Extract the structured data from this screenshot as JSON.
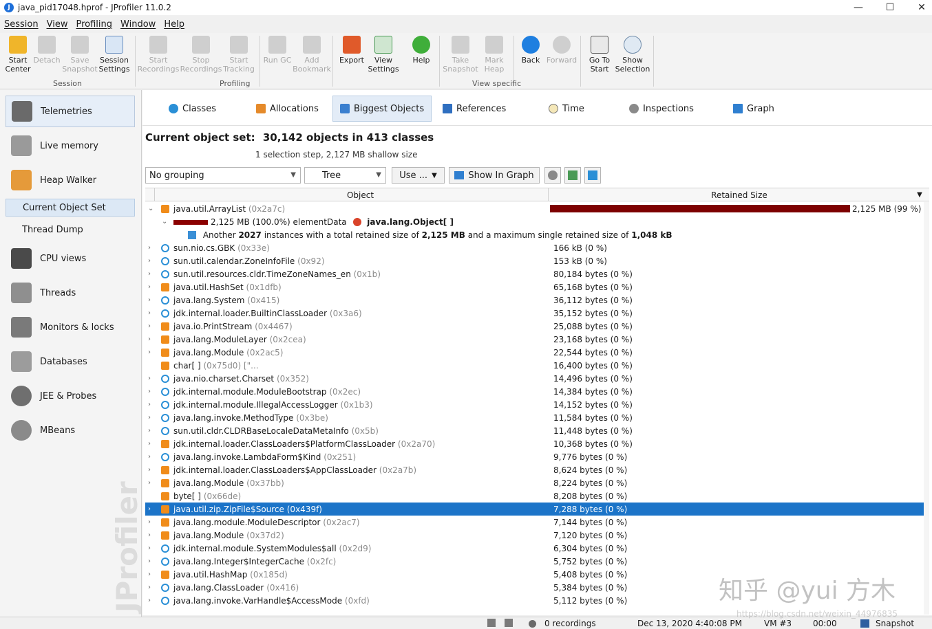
{
  "window": {
    "title": "java_pid17048.hprof - JProfiler 11.0.2",
    "controls": [
      "—",
      "☐",
      "✕"
    ]
  },
  "menu": [
    "Session",
    "View",
    "Profiling",
    "Window",
    "Help"
  ],
  "toolbar": {
    "buttons": [
      {
        "label": "Start\nCenter",
        "icon": "start-center-icon",
        "enabled": true
      },
      {
        "label": "Detach",
        "icon": "detach-icon",
        "enabled": false
      },
      {
        "label": "Save\nSnapshot",
        "icon": "save-snapshot-icon",
        "enabled": false
      },
      {
        "label": "Session\nSettings",
        "icon": "session-settings-icon",
        "enabled": true
      },
      {
        "label": "Start\nRecordings",
        "icon": "start-recordings-icon",
        "enabled": false
      },
      {
        "label": "Stop\nRecordings",
        "icon": "stop-recordings-icon",
        "enabled": false
      },
      {
        "label": "Start\nTracking",
        "icon": "start-tracking-icon",
        "enabled": false
      },
      {
        "label": "Run GC",
        "icon": "run-gc-icon",
        "enabled": false
      },
      {
        "label": "Add\nBookmark",
        "icon": "add-bookmark-icon",
        "enabled": false
      },
      {
        "label": "Export",
        "icon": "export-icon",
        "enabled": true
      },
      {
        "label": "View\nSettings",
        "icon": "view-settings-icon",
        "enabled": true
      },
      {
        "label": "Help",
        "icon": "help-icon",
        "enabled": true
      },
      {
        "label": "Take\nSnapshot",
        "icon": "take-snapshot-icon",
        "enabled": false
      },
      {
        "label": "Mark\nHeap",
        "icon": "mark-heap-icon",
        "enabled": false
      },
      {
        "label": "Back",
        "icon": "back-icon",
        "enabled": true
      },
      {
        "label": "Forward",
        "icon": "forward-icon",
        "enabled": false
      },
      {
        "label": "Go To\nStart",
        "icon": "go-to-start-icon",
        "enabled": true
      },
      {
        "label": "Show\nSelection",
        "icon": "show-selection-icon",
        "enabled": true
      }
    ],
    "groups": [
      "Session",
      "Profiling",
      "View specific"
    ]
  },
  "sidebar": {
    "items": [
      {
        "label": "Telemetries",
        "icon": "telemetries-icon",
        "active": true
      },
      {
        "label": "Live memory",
        "icon": "live-memory-icon"
      },
      {
        "label": "Heap Walker",
        "icon": "heap-walker-icon"
      },
      {
        "label": "CPU views",
        "icon": "cpu-views-icon"
      },
      {
        "label": "Threads",
        "icon": "threads-icon"
      },
      {
        "label": "Monitors & locks",
        "icon": "monitors-locks-icon"
      },
      {
        "label": "Databases",
        "icon": "databases-icon"
      },
      {
        "label": "JEE & Probes",
        "icon": "jee-probes-icon"
      },
      {
        "label": "MBeans",
        "icon": "mbeans-icon"
      }
    ],
    "subitems": [
      {
        "label": "Current Object Set",
        "active": true
      },
      {
        "label": "Thread Dump"
      }
    ],
    "watermark": "JProfiler"
  },
  "tabs": [
    {
      "label": "Classes",
      "icon": "classes-icon"
    },
    {
      "label": "Allocations",
      "icon": "allocations-icon"
    },
    {
      "label": "Biggest Objects",
      "icon": "biggest-objects-icon",
      "active": true
    },
    {
      "label": "References",
      "icon": "references-icon"
    },
    {
      "label": "Time",
      "icon": "time-icon"
    },
    {
      "label": "Inspections",
      "icon": "inspections-icon"
    },
    {
      "label": "Graph",
      "icon": "graph-icon"
    }
  ],
  "object_set": {
    "label": "Current object set:",
    "value": "30,142 objects in 413 classes",
    "sub": "1 selection step, 2,127 MB shallow size"
  },
  "controls": {
    "grouping": "No grouping",
    "view": "Tree",
    "use": "Use ...",
    "show_graph": "Show In Graph"
  },
  "table": {
    "columns": [
      "Object",
      "Retained Size"
    ],
    "top_row": {
      "name": "java.util.ArrayList",
      "id": "(0x2a7c)",
      "size": "2,125 MB (99 %)",
      "fill": 0.99
    },
    "element_row": {
      "size": "2,125 MB (100.0%) elementData",
      "type": "java.lang.Object[ ]"
    },
    "another_row": {
      "prefix": "Another",
      "count": "2027",
      "mid": "instances with a total retained size of",
      "total": "2,125 MB",
      "mid2": "and a maximum single retained size of",
      "max": "1,048 kB"
    },
    "rows": [
      {
        "name": "sun.nio.cs.GBK",
        "id": "(0x33e)",
        "size": "166 kB (0 %)",
        "kind": "cls",
        "exp": true
      },
      {
        "name": "sun.util.calendar.ZoneInfoFile",
        "id": "(0x92)",
        "size": "153 kB (0 %)",
        "kind": "cls",
        "exp": true
      },
      {
        "name": "sun.util.resources.cldr.TimeZoneNames_en",
        "id": "(0x1b)",
        "size": "80,184 bytes (0 %)",
        "kind": "cls",
        "exp": true
      },
      {
        "name": "java.util.HashSet",
        "id": "(0x1dfb)",
        "size": "65,168 bytes (0 %)",
        "kind": "obj",
        "exp": true
      },
      {
        "name": "java.lang.System",
        "id": "(0x415)",
        "size": "36,112 bytes (0 %)",
        "kind": "cls",
        "exp": true
      },
      {
        "name": "jdk.internal.loader.BuiltinClassLoader",
        "id": "(0x3a6)",
        "size": "35,152 bytes (0 %)",
        "kind": "cls",
        "exp": true
      },
      {
        "name": "java.io.PrintStream",
        "id": "(0x4467)",
        "size": "25,088 bytes (0 %)",
        "kind": "obj",
        "exp": true
      },
      {
        "name": "java.lang.ModuleLayer",
        "id": "(0x2cea)",
        "size": "23,168 bytes (0 %)",
        "kind": "obj",
        "exp": true
      },
      {
        "name": "java.lang.Module",
        "id": "(0x2ac5)",
        "size": "22,544 bytes (0 %)",
        "kind": "obj",
        "exp": true
      },
      {
        "name": "char[ ]",
        "id": "(0x75d0) [\"...",
        "size": "16,400 bytes (0 %)",
        "kind": "obj",
        "exp": false
      },
      {
        "name": "java.nio.charset.Charset",
        "id": "(0x352)",
        "size": "14,496 bytes (0 %)",
        "kind": "cls",
        "exp": true
      },
      {
        "name": "jdk.internal.module.ModuleBootstrap",
        "id": "(0x2ec)",
        "size": "14,384 bytes (0 %)",
        "kind": "cls",
        "exp": true
      },
      {
        "name": "jdk.internal.module.IllegalAccessLogger",
        "id": "(0x1b3)",
        "size": "14,152 bytes (0 %)",
        "kind": "cls",
        "exp": true
      },
      {
        "name": "java.lang.invoke.MethodType",
        "id": "(0x3be)",
        "size": "11,584 bytes (0 %)",
        "kind": "cls",
        "exp": true
      },
      {
        "name": "sun.util.cldr.CLDRBaseLocaleDataMetaInfo",
        "id": "(0x5b)",
        "size": "11,448 bytes (0 %)",
        "kind": "cls",
        "exp": true
      },
      {
        "name": "jdk.internal.loader.ClassLoaders$PlatformClassLoader",
        "id": "(0x2a70)",
        "size": "10,368 bytes (0 %)",
        "kind": "obj",
        "exp": true
      },
      {
        "name": "java.lang.invoke.LambdaForm$Kind",
        "id": "(0x251)",
        "size": "9,776 bytes (0 %)",
        "kind": "cls",
        "exp": true
      },
      {
        "name": "jdk.internal.loader.ClassLoaders$AppClassLoader",
        "id": "(0x2a7b)",
        "size": "8,624 bytes (0 %)",
        "kind": "obj",
        "exp": true
      },
      {
        "name": "java.lang.Module",
        "id": "(0x37bb)",
        "size": "8,224 bytes (0 %)",
        "kind": "obj",
        "exp": true
      },
      {
        "name": "byte[ ]",
        "id": "(0x66de)",
        "size": "8,208 bytes (0 %)",
        "kind": "obj",
        "exp": false
      },
      {
        "name": "java.util.zip.ZipFile$Source",
        "id": "(0x439f)",
        "size": "7,288 bytes (0 %)",
        "kind": "obj",
        "exp": true,
        "selected": true
      },
      {
        "name": "java.lang.module.ModuleDescriptor",
        "id": "(0x2ac7)",
        "size": "7,144 bytes (0 %)",
        "kind": "obj",
        "exp": true
      },
      {
        "name": "java.lang.Module",
        "id": "(0x37d2)",
        "size": "7,120 bytes (0 %)",
        "kind": "obj",
        "exp": true
      },
      {
        "name": "jdk.internal.module.SystemModules$all",
        "id": "(0x2d9)",
        "size": "6,304 bytes (0 %)",
        "kind": "cls",
        "exp": true
      },
      {
        "name": "java.lang.Integer$IntegerCache",
        "id": "(0x2fc)",
        "size": "5,752 bytes (0 %)",
        "kind": "cls",
        "exp": true
      },
      {
        "name": "java.util.HashMap",
        "id": "(0x185d)",
        "size": "5,408 bytes (0 %)",
        "kind": "obj",
        "exp": true
      },
      {
        "name": "java.lang.ClassLoader",
        "id": "(0x416)",
        "size": "5,384 bytes (0 %)",
        "kind": "cls",
        "exp": true
      },
      {
        "name": "java.lang.invoke.VarHandle$AccessMode",
        "id": "(0xfd)",
        "size": "5,112 bytes (0 %)",
        "kind": "cls",
        "exp": true
      }
    ]
  },
  "status": {
    "recordings": "0 recordings",
    "timestamp": "Dec 13, 2020 4:40:08 PM",
    "vm": "VM #3",
    "time": "00:00",
    "mode": "Snapshot"
  },
  "overlay": {
    "zh": "知乎 @yui 方木",
    "url": "https://blog.csdn.net/weixin_44976835"
  }
}
